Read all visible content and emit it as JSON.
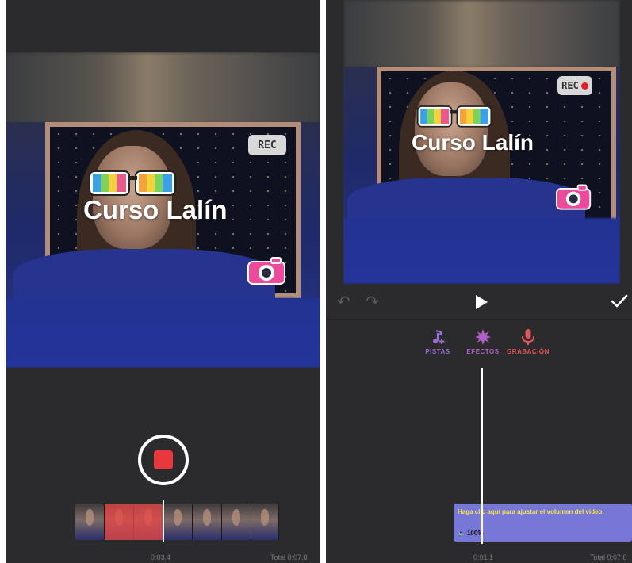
{
  "left": {
    "title_sticker": "Curso Lalín",
    "rec_sticker": "REC",
    "record_button_label": "",
    "current_time": "0:03.4",
    "total_time": "Total 0:07.8"
  },
  "right": {
    "title_sticker": "Curso Lalín",
    "rec_sticker": "REC",
    "tabs": [
      {
        "label": "PISTAS",
        "icon": "music-note-add-icon",
        "color": "#9b6bd6"
      },
      {
        "label": "EFECTOS",
        "icon": "burst-icon",
        "color": "#b45cc8"
      },
      {
        "label": "GRABACIÓN",
        "icon": "microphone-icon",
        "color": "#e0565a"
      }
    ],
    "audio_hint": "Haga clic aquí para ajustar el volumen del video.",
    "audio_volume": "100%",
    "current_time": "0:01.1",
    "total_time": "Total 0:07.8"
  },
  "colors": {
    "record_red": "#e7383d",
    "audio_track": "#7777d8",
    "hint_yellow": "#f3e64d"
  }
}
